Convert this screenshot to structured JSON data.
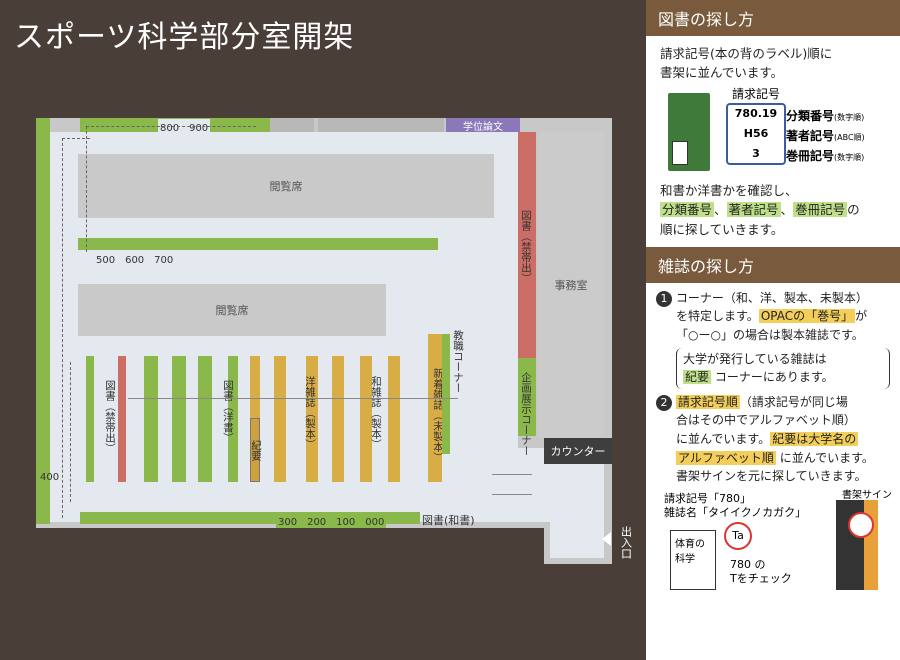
{
  "page_title": "スポーツ科学部分室開架",
  "plan": {
    "reading_seat_1": "閲覧席",
    "reading_seat_2": "閲覧席",
    "office": "事務室",
    "counter": "カウンター",
    "thesis": "学位論文",
    "exit": "出入口",
    "top_nums": "800　900",
    "mid_nums": "500　600　700",
    "bottom_nums": "300　200　100　000",
    "left_num": "400",
    "books_ja_label": "図書(和書)",
    "v_restricted_right": "図書（禁帯出）",
    "v_restricted_left": "図書（禁帯出）",
    "v_western_books": "図書（洋書）",
    "v_kiyo": "紀要",
    "v_western_mag": "洋雑誌（製本）",
    "v_ja_mag": "和雑誌（製本）",
    "v_new_mag": "新着雑誌（未製本）",
    "v_faculty": "教職コーナー",
    "v_exhibit": "企画展示コーナー"
  },
  "howto_books": {
    "header": "図書の探し方",
    "intro_1": "請求記号(本の背のラベル)順に",
    "intro_2": "書架に並んでいます。",
    "label_title": "請求記号",
    "row1_code": "780.19",
    "row1_label": "分類番号",
    "row1_note": "(数字順)",
    "row2_code": "H56",
    "row2_label": "著者記号",
    "row2_note": "(ABC順)",
    "row3_code": "3",
    "row3_label": "巻冊記号",
    "row3_note": "(数字順)",
    "body_1": "和書か洋書かを確認し、",
    "kw_class": "分類番号",
    "sep_1": "、",
    "kw_author": "著者記号",
    "sep_2": "、",
    "kw_vol": "巻冊記号",
    "body_2_tail": "の",
    "body_3": "順に探していきます。"
  },
  "howto_mags": {
    "header": "雑誌の探し方",
    "s1_num": "1",
    "s1_a": "コーナー（和、洋、製本、未製本）",
    "s1_b": "を特定します。",
    "s1_kw": "OPACの「巻号」",
    "s1_c": "が",
    "s1_d": "「○ー○」の場合は製本雑誌です。",
    "note_a": "大学が発行している雑誌は",
    "note_kw": "紀要",
    "note_b": "コーナーにあります。",
    "s2_num": "2",
    "s2_kw": "請求記号順",
    "s2_a": "（請求記号が同じ場",
    "s2_b": "合はその中でアルファベット順）",
    "s2_c": "に並んでいます。",
    "s2_kw2": "紀要は大学名の",
    "s2_kw3": "アルファベット順",
    "s2_d": "に並んでいます。",
    "s2_e": "書架サインを元に探していきます。",
    "ex_line1": "請求記号「780」",
    "ex_line2": "雑誌名「タイイクノカガク」",
    "sign_label": "書架サイン",
    "book_title": "体育の科学",
    "ta": "Ta",
    "check_1": "780 の",
    "check_2": "Tをチェック"
  }
}
